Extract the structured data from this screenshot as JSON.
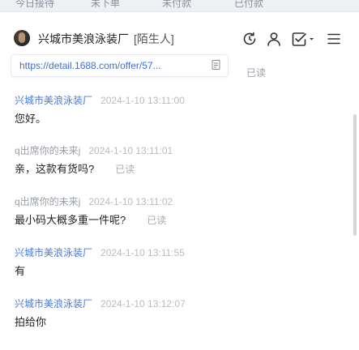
{
  "top_tabs": [
    "今日接待",
    "未下单",
    "未付款",
    "已付款"
  ],
  "header": {
    "shop_name": "兴城市美浪泳装厂",
    "tag": "[陌生人]",
    "icons": [
      "refresh-icon",
      "user-icon",
      "checklist-icon",
      "menu-icon"
    ]
  },
  "link_card": {
    "url": "https://detail.1688.com/offer/57..."
  },
  "read_label": "已读",
  "messages": [
    {
      "sender": "兴城市美浪泳装厂",
      "time": "2024-1-10 13:11:00",
      "text": "您好。",
      "read": ""
    },
    {
      "sender": "q出席你的未来j",
      "time": "2024-1-10 13:11:01",
      "text": "亲，这款有货吗?",
      "read": "已读"
    },
    {
      "sender": "q出席你的未来j",
      "time": "2024-1-10 13:11:02",
      "text": "最小码大概多重一件呢?",
      "read": "已读"
    },
    {
      "sender": "兴城市美浪泳装厂",
      "time": "2024-1-10 13:11:55",
      "text": "有",
      "read": ""
    },
    {
      "sender": "兴城市美浪泳装厂",
      "time": "2024-1-10 13:12:07",
      "text": "拍给你",
      "read": ""
    }
  ],
  "colors": {
    "seller_name": "#4a79d8",
    "buyer_name": "#9aa0a6",
    "link": "#3d6fd8",
    "timestamp": "#b8bcc2"
  }
}
